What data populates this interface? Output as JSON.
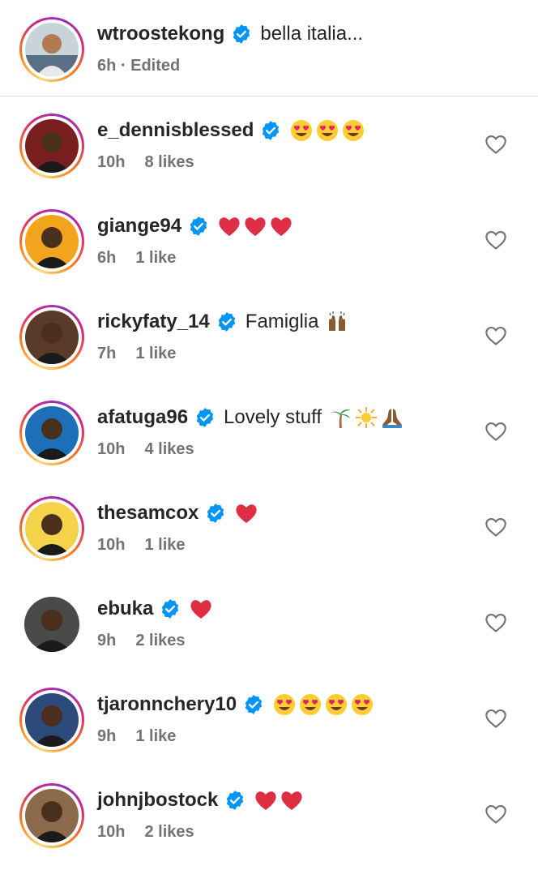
{
  "caption": {
    "username": "wtroostekong",
    "text": "bella italia...",
    "time": "6h · Edited"
  },
  "comments": [
    {
      "username": "e_dennisblessed",
      "text": "",
      "emojis": [
        "heart-eyes",
        "heart-eyes",
        "heart-eyes"
      ],
      "time": "10h",
      "likes": "8 likes",
      "ring": true
    },
    {
      "username": "giange94",
      "text": "",
      "emojis": [
        "red-heart",
        "red-heart",
        "red-heart"
      ],
      "time": "6h",
      "likes": "1 like",
      "ring": true
    },
    {
      "username": "rickyfaty_14",
      "text": "Famiglia",
      "emojis": [
        "raising-hands"
      ],
      "time": "7h",
      "likes": "1 like",
      "ring": true
    },
    {
      "username": "afatuga96",
      "text": "Lovely stuff",
      "emojis": [
        "palm-tree",
        "sun",
        "folded-hands"
      ],
      "time": "10h",
      "likes": "4 likes",
      "ring": true
    },
    {
      "username": "thesamcox",
      "text": "",
      "emojis": [
        "red-heart"
      ],
      "time": "10h",
      "likes": "1 like",
      "ring": true
    },
    {
      "username": "ebuka",
      "text": "",
      "emojis": [
        "red-heart"
      ],
      "time": "9h",
      "likes": "2 likes",
      "ring": false
    },
    {
      "username": "tjaronnchery10",
      "text": "",
      "emojis": [
        "heart-eyes",
        "heart-eyes",
        "heart-eyes",
        "heart-eyes"
      ],
      "time": "9h",
      "likes": "1 like",
      "ring": true
    },
    {
      "username": "johnjbostock",
      "text": "",
      "emojis": [
        "red-heart",
        "red-heart"
      ],
      "time": "10h",
      "likes": "2 likes",
      "ring": true
    }
  ],
  "colors": {
    "verified": "#0095f6",
    "heart": "#e0245e",
    "muted": "#737373",
    "divider": "#dbdbdb"
  }
}
